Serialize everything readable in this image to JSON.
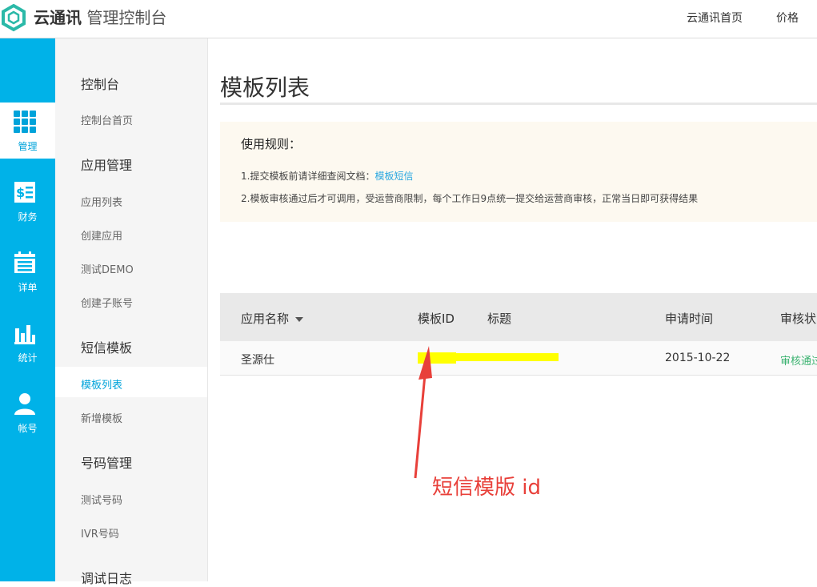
{
  "header": {
    "brand_bold": "云通讯",
    "brand_rest": "管理控制台",
    "nav": [
      "云通讯首页",
      "价格"
    ]
  },
  "rail": {
    "items": [
      {
        "label": "管理",
        "icon": "grid-icon",
        "active": true
      },
      {
        "label": "财务",
        "icon": "bill-icon",
        "active": false
      },
      {
        "label": "详单",
        "icon": "calendar-list-icon",
        "active": false
      },
      {
        "label": "统计",
        "icon": "bar-chart-icon",
        "active": false
      },
      {
        "label": "帐号",
        "icon": "user-icon",
        "active": false
      }
    ]
  },
  "submenu": {
    "groups": [
      {
        "title": "控制台",
        "items": [
          "控制台首页"
        ]
      },
      {
        "title": "应用管理",
        "items": [
          "应用列表",
          "创建应用",
          "测试DEMO",
          "创建子账号"
        ]
      },
      {
        "title": "短信模板",
        "items": [
          "模板列表",
          "新增模板"
        ]
      },
      {
        "title": "号码管理",
        "items": [
          "测试号码",
          "IVR号码"
        ]
      },
      {
        "title": "调试日志",
        "items": []
      }
    ],
    "active_item": "模板列表"
  },
  "main": {
    "title": "模板列表",
    "rules": {
      "title": "使用规则：",
      "line1_text": "1.提交模板前请详细查阅文档：",
      "line1_link": "模板短信",
      "line2": "2.模板审核通过后才可调用，受运营商限制，每个工作日9点统一提交给运营商审核，正常当日即可获得结果"
    },
    "table": {
      "headers": [
        "应用名称",
        "模板ID",
        "标题",
        "申请时间",
        "审核状"
      ],
      "rows": [
        {
          "app": "圣源仕",
          "id": "",
          "title": "",
          "date": "2015-10-22",
          "status": "审核通过"
        }
      ]
    }
  },
  "annotation": {
    "text": "短信模版 id"
  },
  "colors": {
    "rail": "#00b2e8",
    "accent": "#00a3da",
    "status_ok": "#3cb371",
    "annotation": "#e8403a",
    "highlight": "#ffff00"
  }
}
